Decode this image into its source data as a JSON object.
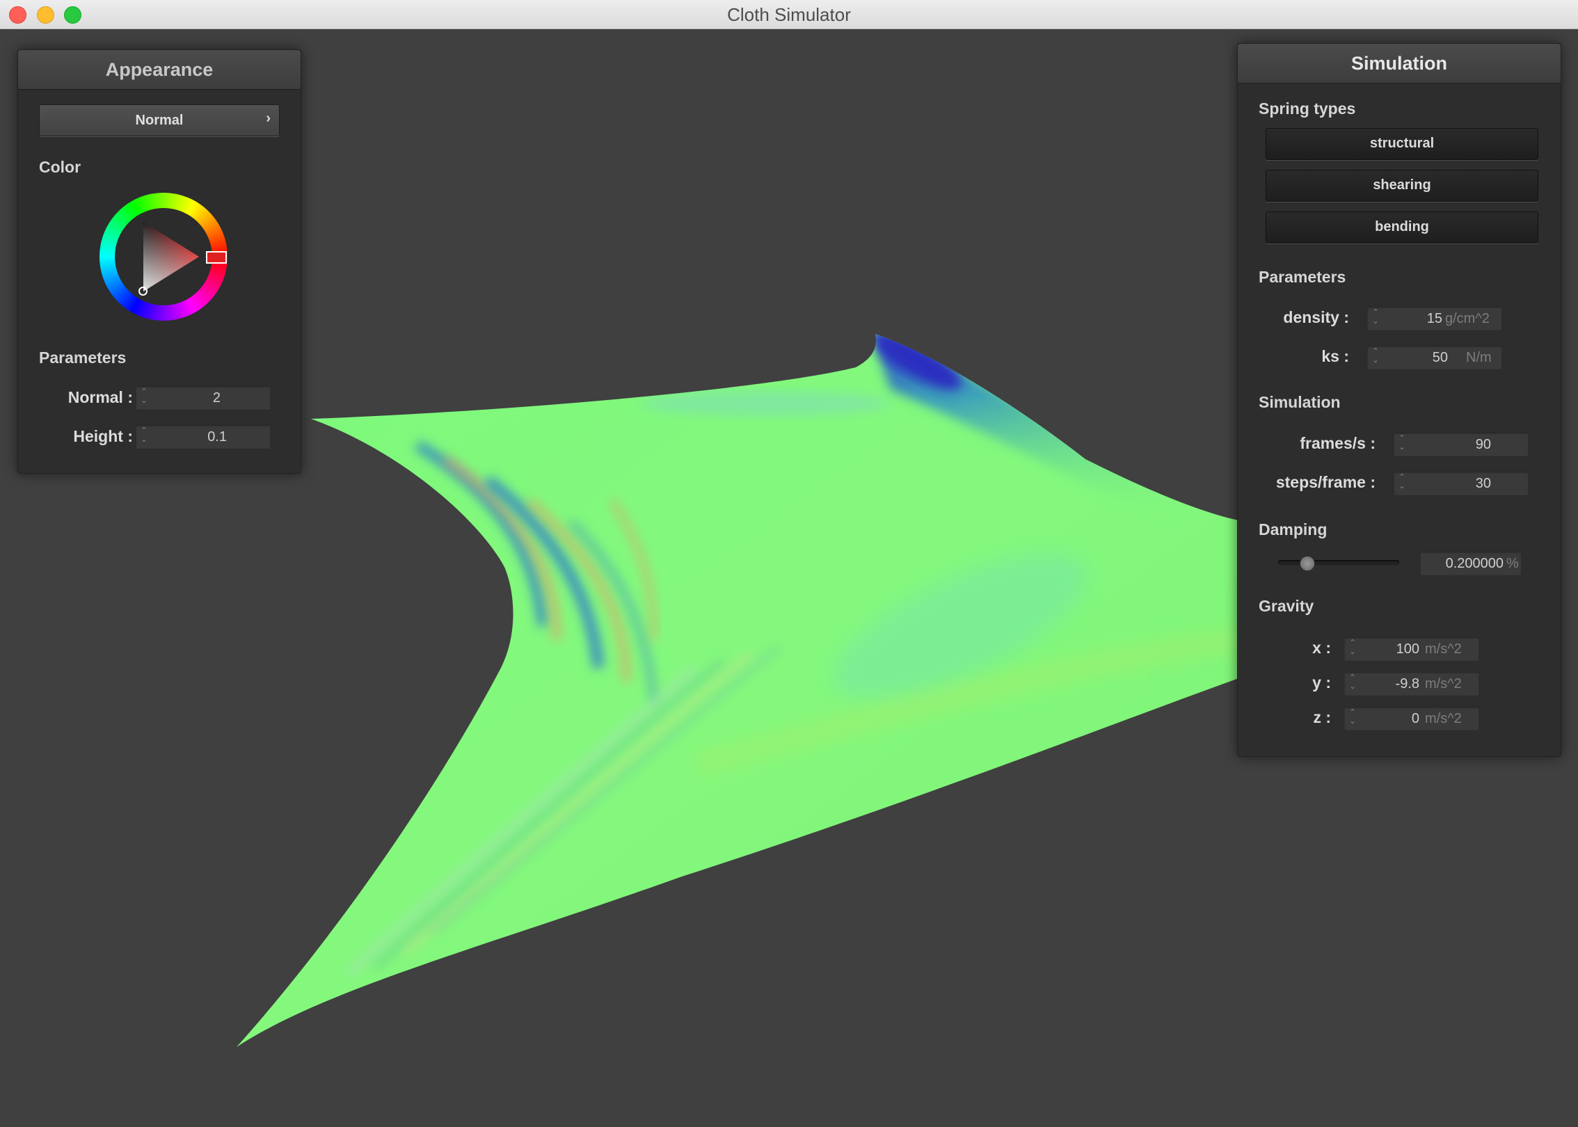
{
  "window": {
    "title": "Cloth Simulator"
  },
  "appearance": {
    "title": "Appearance",
    "shader_selected": "Normal",
    "shader_arrow": "›",
    "color_label": "Color",
    "parameters_label": "Parameters",
    "normal": {
      "label": "Normal :",
      "value": "2"
    },
    "height": {
      "label": "Height :",
      "value": "0.1"
    },
    "color_hex": "#e02020"
  },
  "simulation": {
    "title": "Simulation",
    "spring_types_label": "Spring types",
    "spring_types": [
      "structural",
      "shearing",
      "bending"
    ],
    "parameters_label": "Parameters",
    "density": {
      "label": "density :",
      "value": "15",
      "unit": "g/cm^2"
    },
    "ks": {
      "label": "ks :",
      "value": "50",
      "unit": "N/m"
    },
    "simulation_label": "Simulation",
    "frames_per_s": {
      "label": "frames/s :",
      "value": "90"
    },
    "steps_per_frame": {
      "label": "steps/frame :",
      "value": "30"
    },
    "damping_label": "Damping",
    "damping": {
      "value": "0.200000",
      "unit": "%",
      "slider_fraction": 0.2
    },
    "gravity_label": "Gravity",
    "gravity": {
      "x": {
        "label": "x :",
        "value": "100",
        "unit": "m/s^2"
      },
      "y": {
        "label": "y :",
        "value": "-9.8",
        "unit": "m/s^2"
      },
      "z": {
        "label": "z :",
        "value": "0",
        "unit": "m/s^2"
      }
    }
  },
  "colors": {
    "background": "#404040",
    "cloth": "#7ef87a",
    "panel": "#2c2c2c"
  }
}
